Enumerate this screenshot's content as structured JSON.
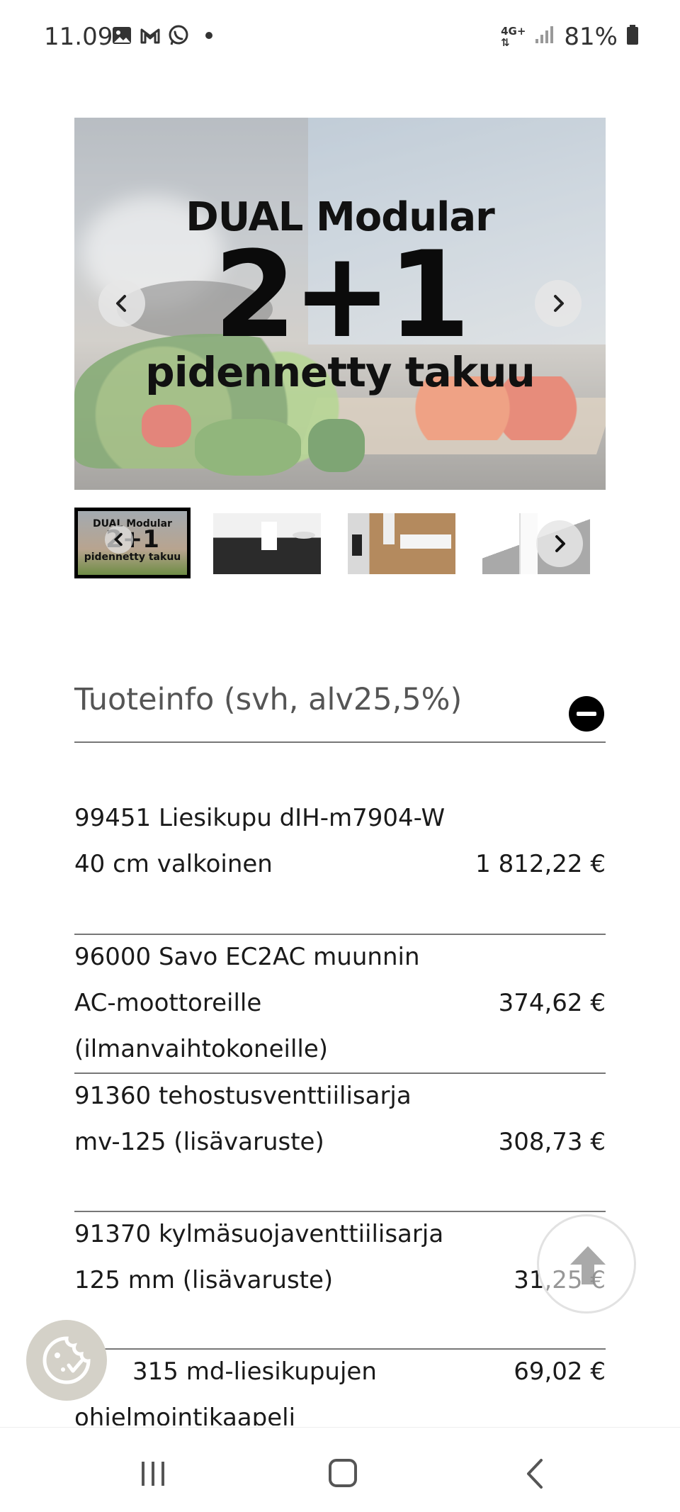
{
  "status_bar": {
    "time": "11.09",
    "network": "4G+",
    "battery": "81%",
    "notification_icons": [
      "gallery-icon",
      "gmail-icon",
      "whatsapp-icon",
      "dot-icon"
    ]
  },
  "carousel": {
    "slide_title_line1": "DUAL Modular",
    "slide_title_line2": "2+1",
    "slide_title_line3": "pidennetty takuu",
    "thumb1_line1": "DUAL Modular",
    "thumb1_line2": "2+1",
    "thumb1_line3": "pidennetty takuu",
    "prev_icon": "chevron-left-icon",
    "next_icon": "chevron-right-icon"
  },
  "product_info": {
    "title": "Tuoteinfo (svh, alv25,5%)",
    "collapse_icon": "minus-circle-icon",
    "items": [
      {
        "name_line1": "99451 Liesikupu dIH-m7904-W",
        "name_line2": "40 cm valkoinen",
        "name_line3": "",
        "price": "1 812,22 €"
      },
      {
        "name_line1": "96000 Savo EC2AC muunnin",
        "name_line2": "AC-moottoreille",
        "name_line3": "(ilmanvaihtokoneille)",
        "price": "374,62 €"
      },
      {
        "name_line1": "91360 tehostusventtiilisarja",
        "name_line2": "mv-125 (lisävaruste)",
        "name_line3": "",
        "price": "308,73 €"
      },
      {
        "name_line1": "91370 kylmäsuojaventtiilisarja",
        "name_line2": "125 mm (lisävaruste)",
        "name_line3": "",
        "price": "31,25 €"
      },
      {
        "name_line1": "315 md-liesikupujen",
        "name_line2": "ohjelmointikaapeli",
        "name_line3": "",
        "price": "69,02 €"
      }
    ]
  },
  "floating": {
    "scroll_top_icon": "arrow-up-icon",
    "cookie_icon": "cookie-icon"
  },
  "nav_bar": {
    "recents_icon": "recents-icon",
    "home_icon": "home-icon",
    "back_icon": "back-icon"
  }
}
